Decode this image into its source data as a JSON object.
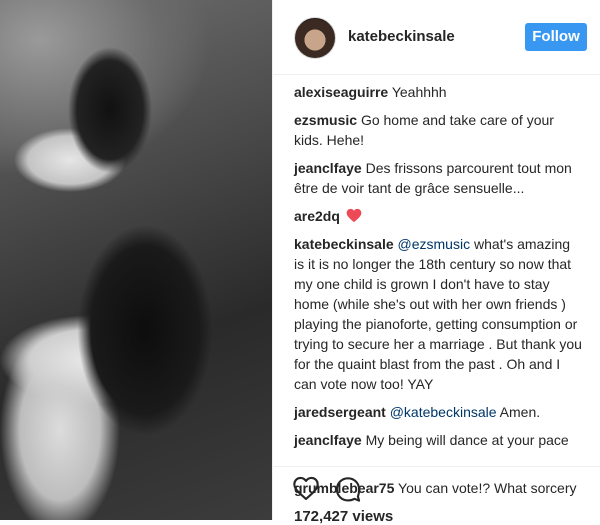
{
  "post": {
    "username": "katebeckinsale",
    "follow_label": "Follow",
    "views": "172,427 views"
  },
  "comments": [
    {
      "user": "alexiseaguirre",
      "mention": "",
      "text": "Yeahhhh"
    },
    {
      "user": "ezsmusic",
      "mention": "",
      "text": "Go home and take care of your kids. Hehe!"
    },
    {
      "user": "jeanclfaye",
      "mention": "",
      "text": "Des frissons parcourent tout mon être de voir tant de grâce sensuelle..."
    },
    {
      "user": "are2dq",
      "mention": "",
      "text": "",
      "emoji": "red-heart"
    },
    {
      "user": "katebeckinsale",
      "mention": "@ezsmusic",
      "text": "what's amazing is it is no longer the 18th century so now that my one child is grown I don't have to stay home (while she's out with her own friends ) playing the pianoforte, getting consumption or trying to secure her a marriage . But thank you for the quaint blast from the past . Oh and I can vote now too! YAY"
    },
    {
      "user": "jaredsergeant",
      "mention": "@katebeckinsale",
      "text": "Amen."
    },
    {
      "user": "jeanclfaye",
      "mention": "",
      "text": "My being will dance at your pace this afternoon... Yeahhh..."
    },
    {
      "user": "grumblebear75",
      "mention": "",
      "text": "You can vote!? What sorcery"
    }
  ],
  "icons": {
    "like": "heart-outline-icon",
    "comment": "comment-bubble-icon"
  },
  "colors": {
    "follow_button": "#3897f0",
    "mention": "#003569",
    "heart": "#ed4956"
  }
}
